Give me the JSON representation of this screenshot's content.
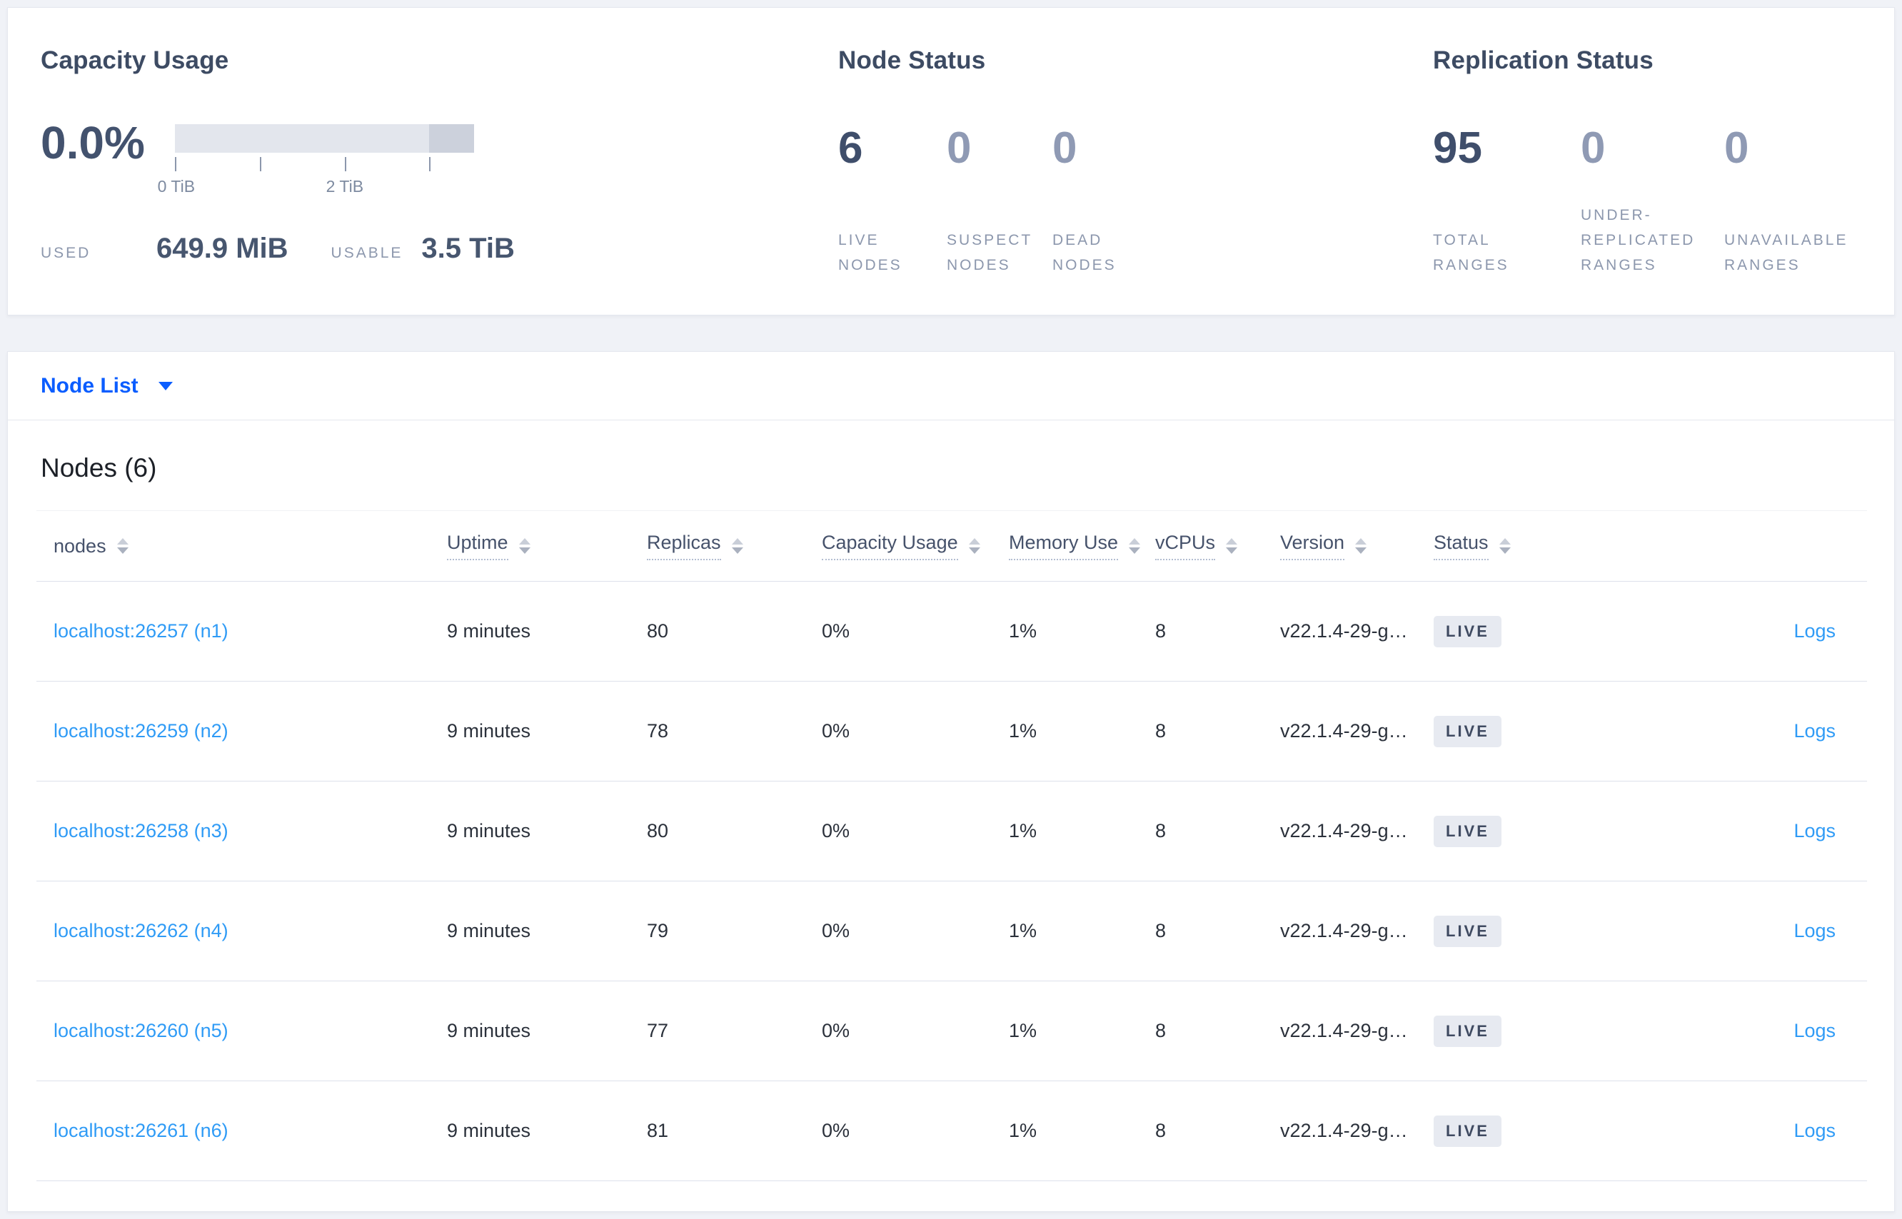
{
  "colors": {
    "page_background": "#f0f2f7",
    "primary_link_blue": "#0b5dff",
    "row_link_blue": "#2f9bf6",
    "stat_primary": "#3f4e6b",
    "stat_muted": "#8f9ab4",
    "bar_light": "#e3e6ed",
    "bar_dark": "#ccd1dc",
    "badge_background": "#e7eaf1",
    "badge_text": "#3f4a61"
  },
  "summary": {
    "capacity": {
      "title": "Capacity Usage",
      "percent": "0.0%",
      "tick_labels": [
        "0 TiB",
        "2 TiB"
      ],
      "used_label": "USED",
      "used_value": "649.9 MiB",
      "usable_label": "USABLE",
      "usable_value": "3.5 TiB"
    },
    "node_status": {
      "title": "Node Status",
      "stats": [
        {
          "value": "6",
          "label": "LIVE NODES"
        },
        {
          "value": "0",
          "label": "SUSPECT NODES"
        },
        {
          "value": "0",
          "label": "DEAD NODES"
        }
      ]
    },
    "replication": {
      "title": "Replication Status",
      "stats": [
        {
          "value": "95",
          "label": "TOTAL RANGES"
        },
        {
          "value": "0",
          "label": "UNDER-REPLICATED RANGES"
        },
        {
          "value": "0",
          "label": "UNAVAILABLE RANGES"
        }
      ]
    }
  },
  "selector": {
    "label": "Node List"
  },
  "table": {
    "title": "Nodes (6)",
    "columns": [
      "nodes",
      "Uptime",
      "Replicas",
      "Capacity Usage",
      "Memory Use",
      "vCPUs",
      "Version",
      "Status"
    ],
    "rows": [
      {
        "node": "localhost:26257 (n1)",
        "uptime": "9 minutes",
        "replicas": "80",
        "capacity": "0%",
        "memory": "1%",
        "vcpus": "8",
        "version": "v22.1.4-29-g…",
        "status": "LIVE",
        "logs": "Logs"
      },
      {
        "node": "localhost:26259 (n2)",
        "uptime": "9 minutes",
        "replicas": "78",
        "capacity": "0%",
        "memory": "1%",
        "vcpus": "8",
        "version": "v22.1.4-29-g…",
        "status": "LIVE",
        "logs": "Logs"
      },
      {
        "node": "localhost:26258 (n3)",
        "uptime": "9 minutes",
        "replicas": "80",
        "capacity": "0%",
        "memory": "1%",
        "vcpus": "8",
        "version": "v22.1.4-29-g…",
        "status": "LIVE",
        "logs": "Logs"
      },
      {
        "node": "localhost:26262 (n4)",
        "uptime": "9 minutes",
        "replicas": "79",
        "capacity": "0%",
        "memory": "1%",
        "vcpus": "8",
        "version": "v22.1.4-29-g…",
        "status": "LIVE",
        "logs": "Logs"
      },
      {
        "node": "localhost:26260 (n5)",
        "uptime": "9 minutes",
        "replicas": "77",
        "capacity": "0%",
        "memory": "1%",
        "vcpus": "8",
        "version": "v22.1.4-29-g…",
        "status": "LIVE",
        "logs": "Logs"
      },
      {
        "node": "localhost:26261 (n6)",
        "uptime": "9 minutes",
        "replicas": "81",
        "capacity": "0%",
        "memory": "1%",
        "vcpus": "8",
        "version": "v22.1.4-29-g…",
        "status": "LIVE",
        "logs": "Logs"
      }
    ]
  }
}
